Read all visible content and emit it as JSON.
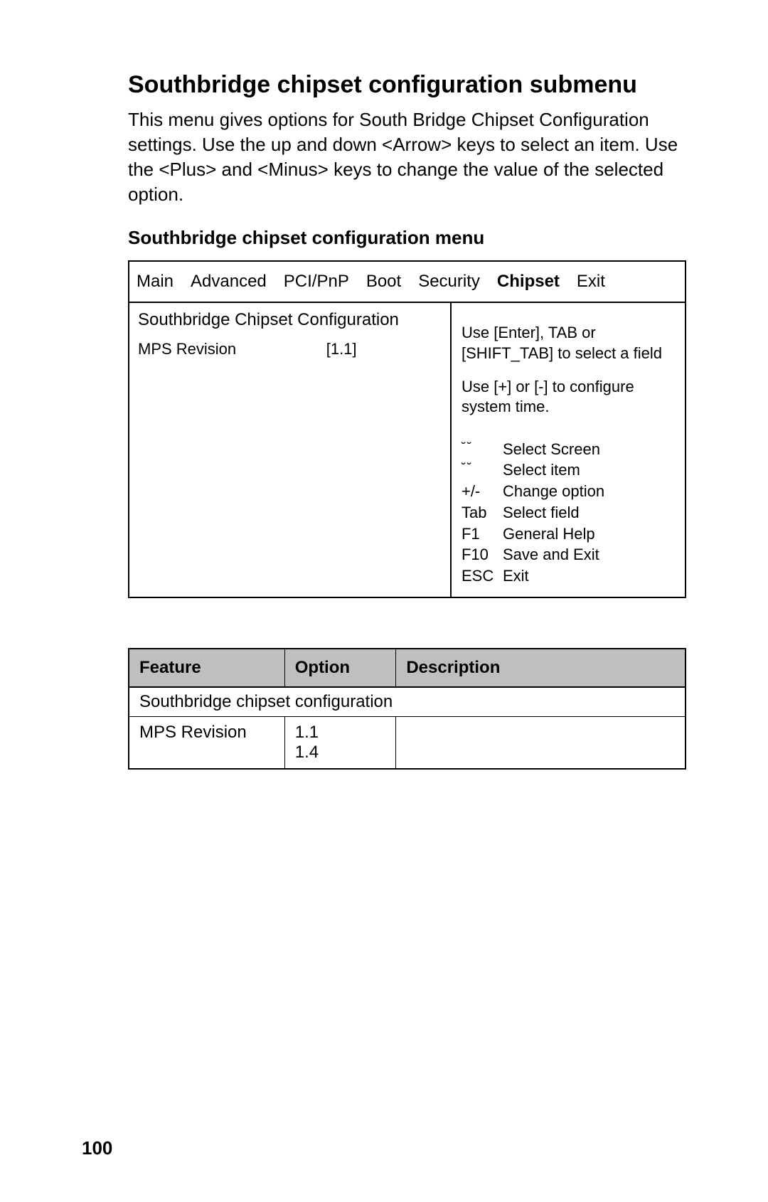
{
  "heading": "Southbridge chipset configuration submenu",
  "intro": "This menu gives options for South Bridge Chipset Configuration settings. Use the up and down <Arrow> keys to select an item. Use the <Plus> and <Minus> keys to change the value of the selected option.",
  "subheading": "Southbridge chipset configuration menu",
  "bios": {
    "tabs": [
      "Main",
      "Advanced",
      "PCI/PnP",
      "Boot",
      "Security",
      "Chipset",
      "Exit"
    ],
    "active_tab": "Chipset",
    "panel_title": "Southbridge Chipset Configuration",
    "setting_label": "MPS Revision",
    "setting_value": "[1.1]",
    "help1": "Use [Enter], TAB or [SHIFT_TAB] to select a field",
    "help2": "Use [+] or [-] to configure system time.",
    "keys": [
      {
        "k": "˘˘",
        "d": "Select Screen"
      },
      {
        "k": "˘˘",
        "d": "Select item"
      },
      {
        "k": "+/-",
        "d": "Change option"
      },
      {
        "k": "Tab",
        "d": "Select field"
      },
      {
        "k": "F1",
        "d": "General Help"
      },
      {
        "k": "F10",
        "d": "Save and Exit"
      },
      {
        "k": "ESC",
        "d": "Exit"
      }
    ]
  },
  "table": {
    "headers": [
      "Feature",
      "Option",
      "Description"
    ],
    "group_row": "Southbridge chipset configuration",
    "rows": [
      {
        "feature": "MPS Revision",
        "option": "1.1\n1.4",
        "description": ""
      }
    ]
  },
  "page_number": "100"
}
